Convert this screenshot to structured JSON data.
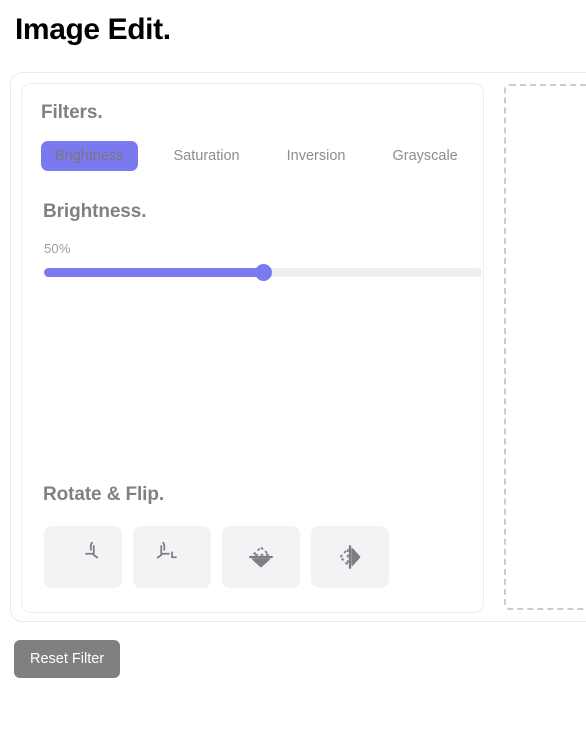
{
  "page": {
    "title": "Image Edit."
  },
  "filters": {
    "heading": "Filters.",
    "tabs": [
      {
        "label": "Brightness",
        "active": true
      },
      {
        "label": "Saturation",
        "active": false
      },
      {
        "label": "Inversion",
        "active": false
      },
      {
        "label": "Grayscale",
        "active": false
      }
    ]
  },
  "slider": {
    "heading": "Brightness.",
    "value_label": "50%",
    "value": 50,
    "min": 0,
    "max": 100
  },
  "rotate": {
    "heading": "Rotate & Flip.",
    "buttons": [
      {
        "icon": "rotate-right-icon",
        "name": "rotate-right-button"
      },
      {
        "icon": "rotate-left-history-icon",
        "name": "rotate-left-button"
      },
      {
        "icon": "flip-vertical-icon",
        "name": "flip-vertical-button"
      },
      {
        "icon": "flip-horizontal-icon",
        "name": "flip-horizontal-button"
      }
    ]
  },
  "preview": {
    "placeholder": ""
  },
  "actions": {
    "reset_label": "Reset Filter"
  },
  "colors": {
    "accent": "#7b79f0",
    "track": "#eceef0",
    "heading": "#818181",
    "tab_text": "#8d8d93",
    "active_tab_text": "#77777f",
    "button_bg": "#f2f3f5",
    "reset_bg": "#808080",
    "card_border": "#e9eaec",
    "dashed_border": "#c9ccd2"
  }
}
